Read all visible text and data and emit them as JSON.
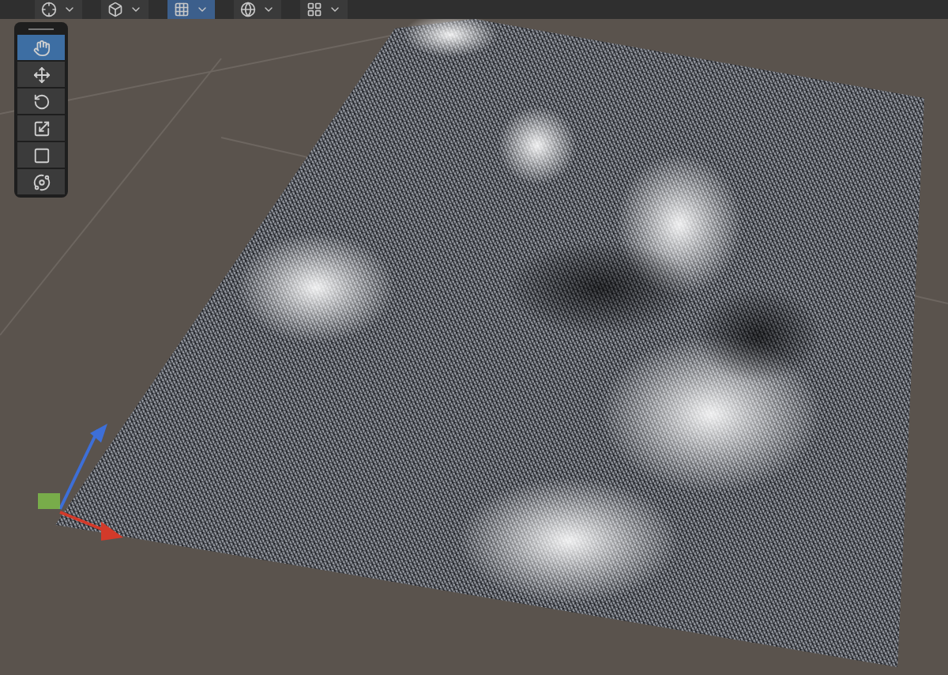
{
  "toolbar": [
    {
      "kind": "pivot",
      "selected": false
    },
    {
      "kind": "global",
      "selected": false
    },
    {
      "kind": "grid",
      "selected": true
    },
    {
      "kind": "gizmos",
      "selected": false
    },
    {
      "kind": "layout",
      "selected": false
    }
  ],
  "tools": [
    {
      "kind": "hand",
      "selected": true
    },
    {
      "kind": "move",
      "selected": false
    },
    {
      "kind": "rotate",
      "selected": false
    },
    {
      "kind": "scale",
      "selected": false
    },
    {
      "kind": "rect",
      "selected": false
    },
    {
      "kind": "transform",
      "selected": false
    }
  ]
}
